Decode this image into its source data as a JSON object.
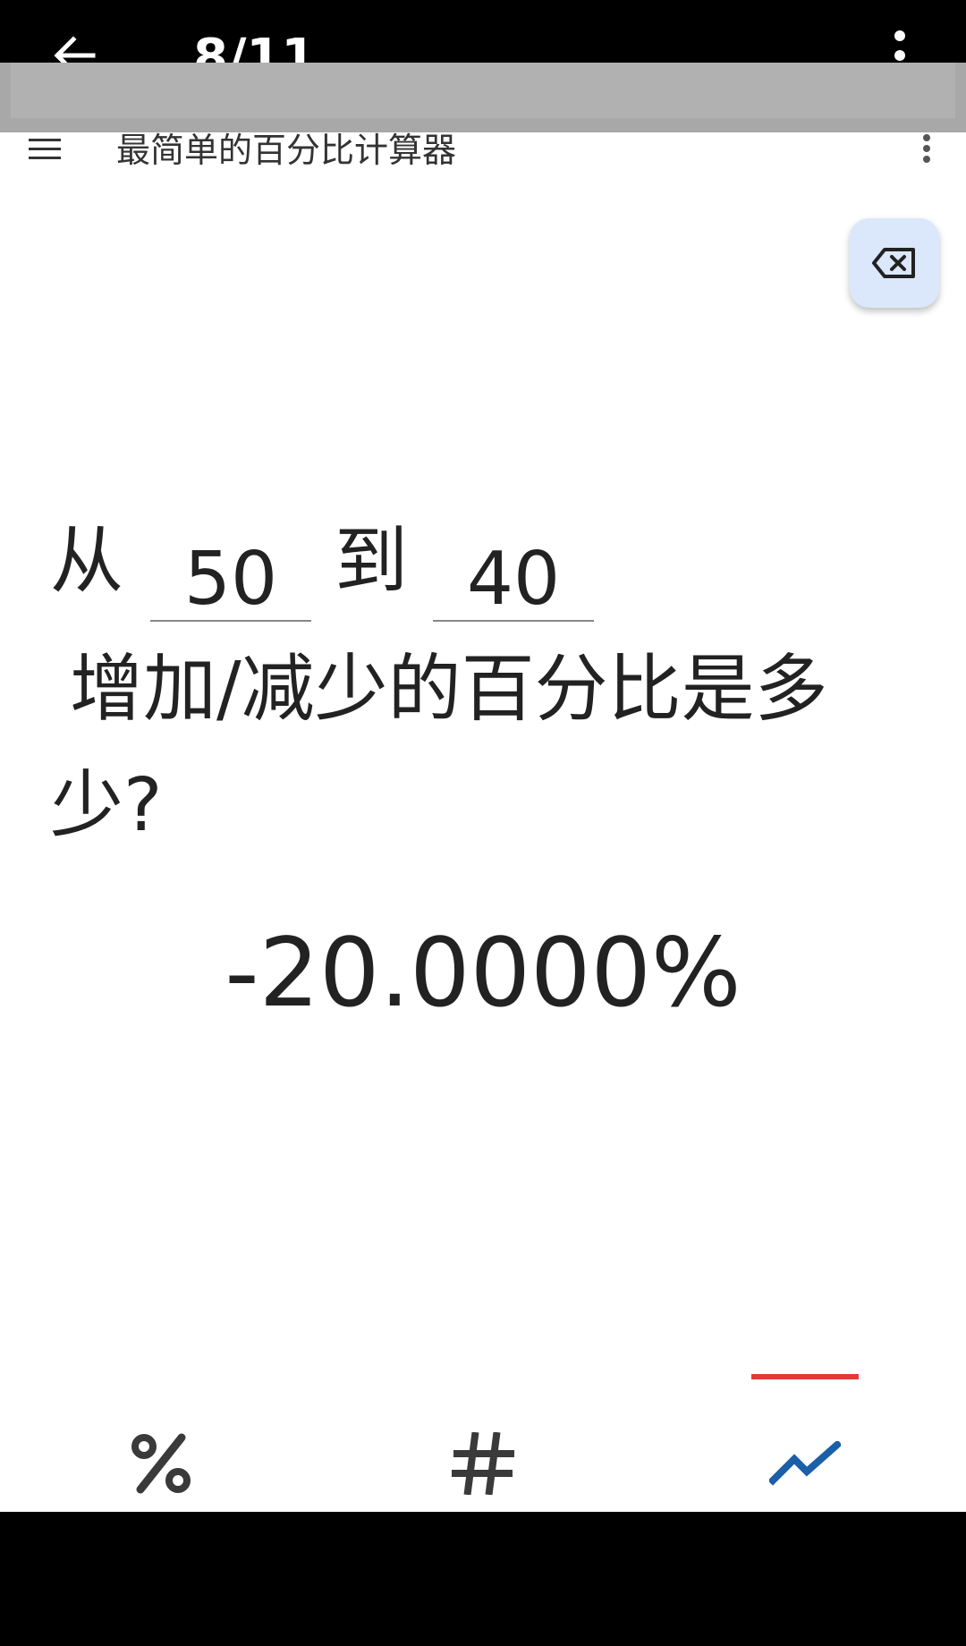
{
  "viewer": {
    "counter": "8/11"
  },
  "app": {
    "title": "最简单的百分比计算器"
  },
  "calculator": {
    "word_from": "从",
    "from_value": "50",
    "word_to": "到",
    "to_value": "40",
    "question_line": "增加/减少的百分比是多",
    "question_tail": "少?",
    "result": "-20.0000%"
  },
  "tabs": [
    {
      "icon": "percent-icon",
      "label": "%"
    },
    {
      "icon": "hash-icon",
      "label": "#"
    },
    {
      "icon": "trending-icon",
      "active": true
    }
  ],
  "colors": {
    "accent_blue": "#1a5fa8",
    "indicator_red": "#e53935",
    "button_bg": "#dbe8fb"
  }
}
